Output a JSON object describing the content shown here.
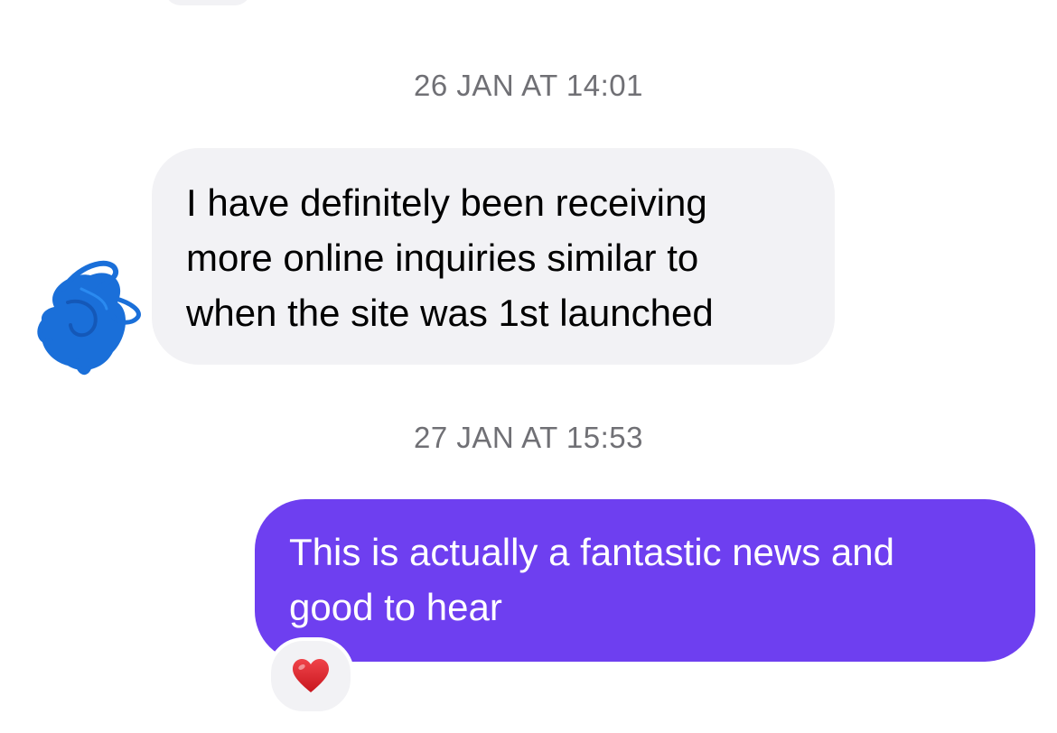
{
  "timestamps": {
    "first": "26 JAN AT 14:01",
    "second": "27 JAN AT 15:53"
  },
  "messages": [
    {
      "direction": "incoming",
      "text": "I have definitely been receiving\nmore online inquiries similar to\nwhen the site was 1st launched"
    },
    {
      "direction": "outgoing",
      "text": "This is actually a fantastic news and\ngood to hear",
      "reaction": "heart-icon"
    }
  ],
  "colors": {
    "incoming_bubble": "#f2f2f5",
    "outgoing_bubble": "#6e3ff0",
    "timestamp_text": "#707075",
    "avatar_scribble": "#1a6fd9",
    "reaction_heart": "#e0242a"
  }
}
